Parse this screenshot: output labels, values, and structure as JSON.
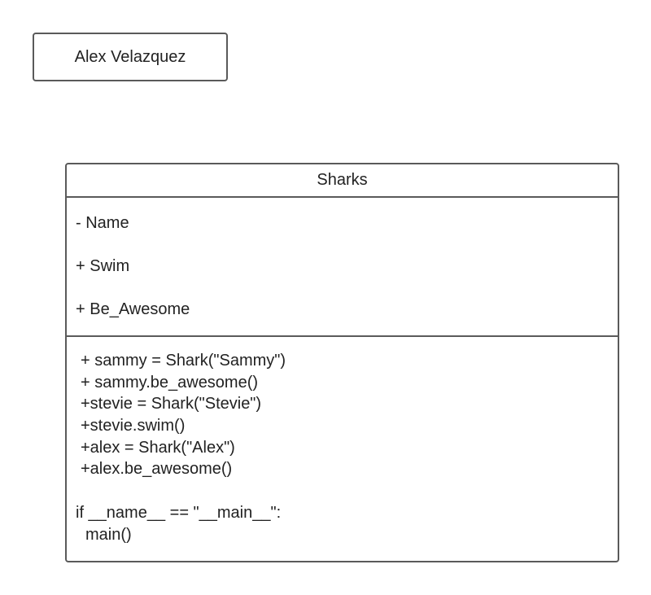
{
  "note_box": {
    "text": "Alex Velazquez"
  },
  "class_box": {
    "title": "Sharks",
    "attributes": [
      "- Name",
      "+ Swim",
      "+ Be_Awesome"
    ],
    "methods": [
      "+ sammy = Shark(\"Sammy\")",
      "+ sammy.be_awesome()",
      "+stevie = Shark(\"Stevie\")",
      "+stevie.swim()",
      "+alex = Shark(\"Alex\")",
      "+alex.be_awesome()"
    ],
    "main_block": [
      "if __name__ == \"__main__\":",
      "main()"
    ]
  }
}
